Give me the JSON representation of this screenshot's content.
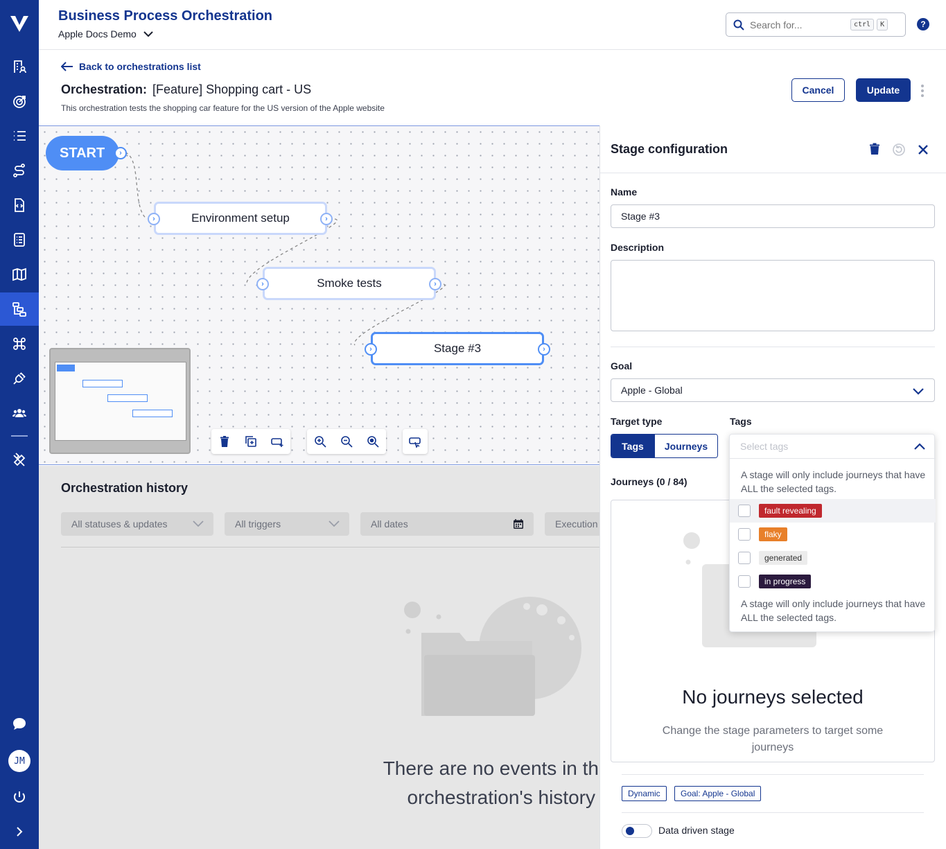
{
  "sidebar": {
    "logo": "vertical-logo-icon",
    "items": [
      {
        "name": "nav-projects",
        "icon": "building-user-icon"
      },
      {
        "name": "nav-goals",
        "icon": "target-icon"
      },
      {
        "name": "nav-list",
        "icon": "list-icon"
      },
      {
        "name": "nav-routes",
        "icon": "route-icon"
      },
      {
        "name": "nav-code",
        "icon": "file-code-icon"
      },
      {
        "name": "nav-checklist",
        "icon": "checklist-icon"
      },
      {
        "name": "nav-map",
        "icon": "map-icon"
      },
      {
        "name": "nav-orchestration",
        "icon": "orchestration-icon",
        "active": true
      },
      {
        "name": "nav-command",
        "icon": "command-icon"
      },
      {
        "name": "nav-integrations",
        "icon": "plug-icon"
      },
      {
        "name": "nav-team",
        "icon": "users-icon"
      },
      {
        "name": "nav-tools",
        "icon": "tools-icon"
      }
    ],
    "avatar_initials": "JM"
  },
  "header": {
    "title": "Business Process Orchestration",
    "project": "Apple Docs Demo",
    "search_placeholder": "Search for...",
    "shortcut_key1": "ctrl",
    "shortcut_key2": "K",
    "help_label": "?"
  },
  "orchestration": {
    "back_label": "Back to orchestrations list",
    "title_prefix": "Orchestration:",
    "title": "[Feature] Shopping cart - US",
    "description": "This orchestration tests the shopping car feature for the US version of the Apple website",
    "cancel_label": "Cancel",
    "update_label": "Update"
  },
  "canvas": {
    "start_label": "START",
    "nodes": [
      {
        "label": "Environment setup"
      },
      {
        "label": "Smoke tests"
      },
      {
        "label": "Stage #3",
        "selected": true
      }
    ]
  },
  "history": {
    "title": "Orchestration history",
    "filters": {
      "statuses": "All statuses & updates",
      "triggers": "All triggers",
      "dates": "All dates",
      "execution": "Execution"
    },
    "empty_line1": "There are no events in th",
    "empty_line2": "orchestration's history"
  },
  "stage_config": {
    "title": "Stage configuration",
    "name_label": "Name",
    "name_value": "Stage #3",
    "description_label": "Description",
    "description_value": "",
    "goal_label": "Goal",
    "goal_value": "Apple - Global",
    "target_type_label": "Target type",
    "target_tags": "Tags",
    "target_journeys": "Journeys",
    "tags_label": "Tags",
    "journeys_count_label": "Journeys (0 / 84)",
    "no_journeys_title": "No journeys selected",
    "no_journeys_sub": "Change the stage parameters to target some journeys",
    "chips": [
      "Dynamic",
      "Goal: Apple - Global"
    ],
    "data_driven_label": "Data driven stage"
  },
  "tags_dropdown": {
    "placeholder": "Select tags",
    "note": "A stage will only include journeys that have ALL the selected tags.",
    "options": [
      {
        "label": "fault revealing",
        "bg": "#c0282e",
        "fg": "#ffffff"
      },
      {
        "label": "flaky",
        "bg": "#e8802a",
        "fg": "#ffffff"
      },
      {
        "label": "generated",
        "bg": "#ececec",
        "fg": "#333333"
      },
      {
        "label": "in progress",
        "bg": "#2b1a3e",
        "fg": "#ffffff"
      }
    ],
    "footer_note": "A stage will only include journeys that have ALL the selected tags."
  },
  "colors": {
    "brand": "#13358f",
    "accent": "#4f8ef5"
  }
}
